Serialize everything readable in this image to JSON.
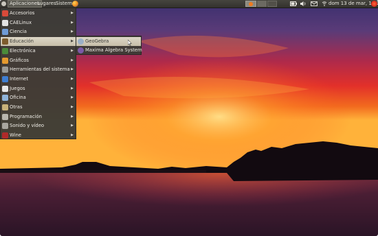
{
  "top_panel": {
    "menus": [
      "Aplicaciones",
      "Lugares",
      "Sistema"
    ],
    "clock": "dom 13 de mar, 14:10",
    "icons": [
      "ubuntu-logo",
      "firefox",
      "battery",
      "volume",
      "mail",
      "network",
      "power"
    ]
  },
  "apps_menu": {
    "items": [
      {
        "label": "Accesorios",
        "icon": "accessories",
        "color": "#d84a3a"
      },
      {
        "label": "CAELinux",
        "icon": "caelinux",
        "color": "#e2e2e2"
      },
      {
        "label": "Ciencia",
        "icon": "science",
        "color": "#6f9bd6"
      },
      {
        "label": "Educación",
        "icon": "education",
        "color": "#7d5c2d"
      },
      {
        "label": "Electrónica",
        "icon": "electronics",
        "color": "#4a8a3a"
      },
      {
        "label": "Gráficos",
        "icon": "graphics",
        "color": "#e49a2f"
      },
      {
        "label": "Herramientas del sistema",
        "icon": "system-tools",
        "color": "#9a9a96"
      },
      {
        "label": "Internet",
        "icon": "internet",
        "color": "#3f7ed1"
      },
      {
        "label": "Juegos",
        "icon": "games",
        "color": "#e8e8e8"
      },
      {
        "label": "Oficina",
        "icon": "office",
        "color": "#8fb3d9"
      },
      {
        "label": "Otras",
        "icon": "other",
        "color": "#c9b27a"
      },
      {
        "label": "Programación",
        "icon": "programming",
        "color": "#b8b6ad"
      },
      {
        "label": "Sonido y vídeo",
        "icon": "sound-video",
        "color": "#a8a69e"
      },
      {
        "label": "Wine",
        "icon": "wine",
        "color": "#b02a2a"
      }
    ],
    "active_index": 3
  },
  "submenu": {
    "items": [
      {
        "label": "GeoGebra",
        "icon": "geogebra",
        "color": "#9bb0c7"
      },
      {
        "label": "Maxima Algebra System",
        "icon": "maxima",
        "color": "#7b5aa8"
      }
    ],
    "active_index": 0
  }
}
